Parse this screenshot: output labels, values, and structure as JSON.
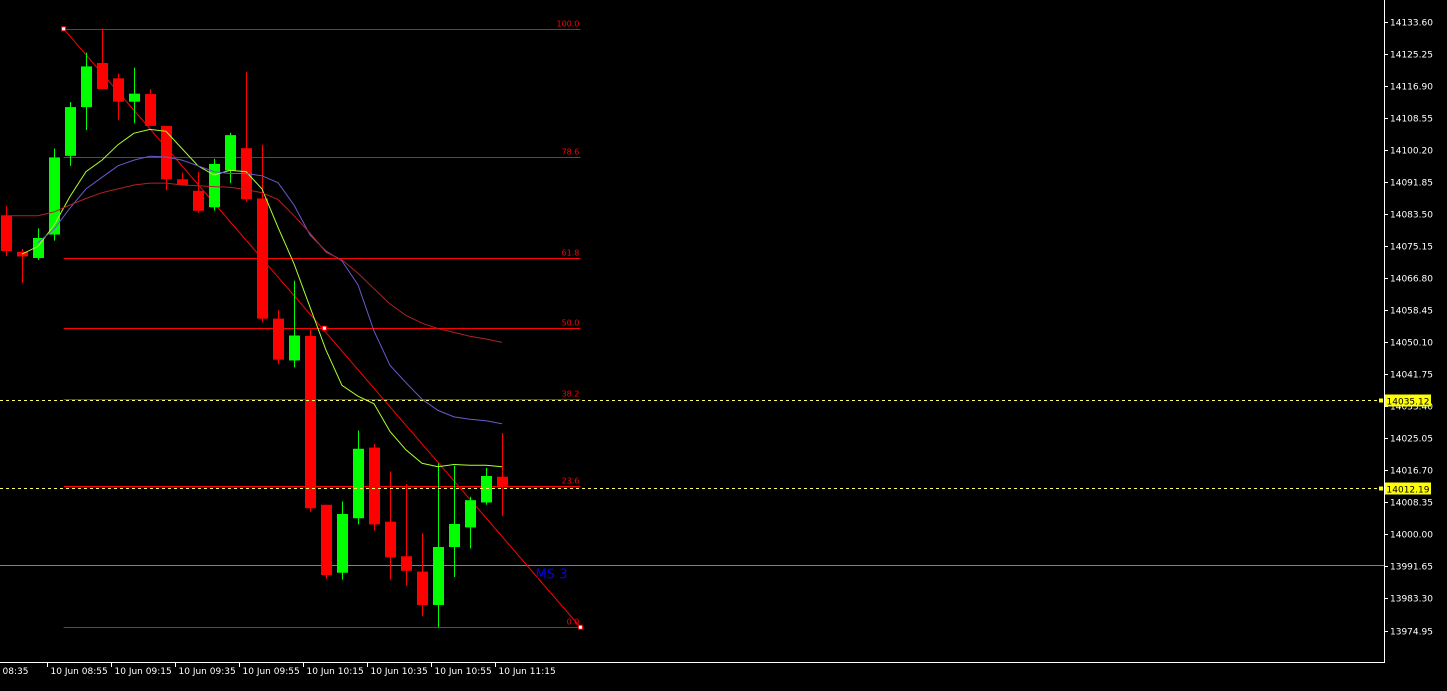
{
  "chart_data": {
    "type": "candlestick",
    "background": "#000000",
    "colors": {
      "bull": "#00ff00",
      "bear": "#ff0000",
      "fib": "#ff0000",
      "ma_fast": "#adff2f",
      "ma_mid": "#6a5acd",
      "ma_slow": "#b22222",
      "hline": "#808080",
      "dashed_level": "#ffff66",
      "price_tag_bg": "#ffff00",
      "axis_text": "#ffffff",
      "ms_label": "#0000ff"
    },
    "y_axis": {
      "ticks": [
        "14133.60",
        "14125.25",
        "14116.90",
        "14108.55",
        "14100.20",
        "14091.85",
        "14083.50",
        "14075.15",
        "14066.80",
        "14058.45",
        "14050.10",
        "14041.75",
        "14033.40",
        "14025.05",
        "14016.70",
        "14008.35",
        "14000.00",
        "13991.65",
        "13983.30",
        "13974.95"
      ],
      "range": [
        13972.0,
        14136.0
      ]
    },
    "x_axis": {
      "labels": [
        {
          "text": "08:35",
          "i": -0.45
        },
        {
          "text": "10 Jun 08:55",
          "i": 2.55
        },
        {
          "text": "10 Jun 09:15",
          "i": 6.55
        },
        {
          "text": "10 Jun 09:35",
          "i": 10.55
        },
        {
          "text": "10 Jun 09:55",
          "i": 14.55
        },
        {
          "text": "10 Jun 10:15",
          "i": 18.55
        },
        {
          "text": "10 Jun 10:35",
          "i": 22.55
        },
        {
          "text": "10 Jun 10:55",
          "i": 26.55
        },
        {
          "text": "10 Jun 11:15",
          "i": 30.55
        }
      ]
    },
    "candles": [
      {
        "o": 14083.0,
        "h": 14085.5,
        "l": 14072.5,
        "c": 14073.8
      },
      {
        "o": 14073.6,
        "h": 14074.3,
        "l": 14065.5,
        "c": 14072.4
      },
      {
        "o": 14072.0,
        "h": 14079.7,
        "l": 14071.5,
        "c": 14077.2
      },
      {
        "o": 14078.1,
        "h": 14100.5,
        "l": 14076.5,
        "c": 14098.2
      },
      {
        "o": 14098.6,
        "h": 14112.6,
        "l": 14096.0,
        "c": 14111.3
      },
      {
        "o": 14111.3,
        "h": 14125.5,
        "l": 14105.3,
        "c": 14121.9
      },
      {
        "o": 14122.8,
        "h": 14131.7,
        "l": 14116.3,
        "c": 14116.0
      },
      {
        "o": 14118.8,
        "h": 14120.0,
        "l": 14107.9,
        "c": 14112.7
      },
      {
        "o": 14112.7,
        "h": 14121.6,
        "l": 14107.1,
        "c": 14114.8
      },
      {
        "o": 14114.7,
        "h": 14116.0,
        "l": 14107.2,
        "c": 14106.4
      },
      {
        "o": 14106.4,
        "h": 14106.4,
        "l": 14089.6,
        "c": 14092.5
      },
      {
        "o": 14092.5,
        "h": 14094.2,
        "l": 14091.4,
        "c": 14091.0
      },
      {
        "o": 14089.5,
        "h": 14094.4,
        "l": 14083.8,
        "c": 14084.3
      },
      {
        "o": 14085.2,
        "h": 14097.8,
        "l": 14084.3,
        "c": 14096.5
      },
      {
        "o": 14094.8,
        "h": 14104.6,
        "l": 14091.5,
        "c": 14104.0
      },
      {
        "o": 14100.6,
        "h": 14120.5,
        "l": 14086.6,
        "c": 14087.3
      },
      {
        "o": 14087.5,
        "h": 14101.5,
        "l": 14055.3,
        "c": 14056.2
      },
      {
        "o": 14056.2,
        "h": 14058.4,
        "l": 14044.3,
        "c": 14045.5
      },
      {
        "o": 14045.3,
        "h": 14066.1,
        "l": 14043.5,
        "c": 14051.8
      },
      {
        "o": 14051.7,
        "h": 14053.3,
        "l": 14005.9,
        "c": 14006.8
      },
      {
        "o": 14007.7,
        "h": 14007.7,
        "l": 13988.4,
        "c": 13989.4
      },
      {
        "o": 13990.0,
        "h": 14008.6,
        "l": 13988.2,
        "c": 14005.3
      },
      {
        "o": 14004.2,
        "h": 14027.1,
        "l": 14002.6,
        "c": 14022.3
      },
      {
        "o": 14022.6,
        "h": 14023.5,
        "l": 14001.0,
        "c": 14002.6
      },
      {
        "o": 14003.3,
        "h": 14016.4,
        "l": 13988.2,
        "c": 13994.0
      },
      {
        "o": 13994.3,
        "h": 14013.1,
        "l": 13986.6,
        "c": 13990.5
      },
      {
        "o": 13990.3,
        "h": 14000.3,
        "l": 13978.7,
        "c": 13981.6
      },
      {
        "o": 13981.6,
        "h": 14018.5,
        "l": 13975.8,
        "c": 13996.7
      },
      {
        "o": 13996.7,
        "h": 14017.8,
        "l": 13988.9,
        "c": 14002.7
      },
      {
        "o": 14001.8,
        "h": 14009.8,
        "l": 13996.3,
        "c": 14008.9
      },
      {
        "o": 14008.3,
        "h": 14017.3,
        "l": 14007.7,
        "c": 14015.2
      },
      {
        "o": 14015.0,
        "h": 14026.4,
        "l": 14004.8,
        "c": 14012.2
      }
    ],
    "moving_averages": [
      {
        "color": "#adff2f",
        "values": [
          [
            1,
            14073.0
          ],
          [
            2,
            14075.0
          ],
          [
            3,
            14080.5
          ],
          [
            4,
            14088.0
          ],
          [
            5,
            14094.5
          ],
          [
            6,
            14097.5
          ],
          [
            7,
            14101.5
          ],
          [
            8,
            14104.5
          ],
          [
            9,
            14105.5
          ],
          [
            10,
            14105.0
          ],
          [
            11,
            14100.5
          ],
          [
            12,
            14096.0
          ],
          [
            13,
            14093.6
          ],
          [
            14,
            14094.8
          ],
          [
            15,
            14094.5
          ],
          [
            16,
            14090.0
          ],
          [
            17,
            14080.0
          ],
          [
            18,
            14070.5
          ],
          [
            19,
            14059.2
          ],
          [
            20,
            14048.0
          ],
          [
            21,
            14038.8
          ],
          [
            22,
            14036.0
          ],
          [
            23,
            14034.0
          ],
          [
            24,
            14026.8
          ],
          [
            25,
            14022.0
          ],
          [
            26,
            14018.5
          ],
          [
            27,
            14017.6
          ],
          [
            28,
            14018.2
          ],
          [
            29,
            14018.0
          ],
          [
            30,
            14018.0
          ],
          [
            31,
            14017.6
          ]
        ]
      },
      {
        "color": "#6a5acd",
        "values": [
          [
            2,
            14076.0
          ],
          [
            3,
            14079.5
          ],
          [
            4,
            14085.0
          ],
          [
            5,
            14090.0
          ],
          [
            6,
            14093.0
          ],
          [
            7,
            14096.0
          ],
          [
            8,
            14097.5
          ],
          [
            9,
            14098.5
          ],
          [
            10,
            14098.3
          ],
          [
            11,
            14097.5
          ],
          [
            12,
            14096.0
          ],
          [
            13,
            14094.5
          ],
          [
            14,
            14094.0
          ],
          [
            15,
            14094.0
          ],
          [
            16,
            14093.4
          ],
          [
            17,
            14091.6
          ],
          [
            18,
            14085.8
          ],
          [
            19,
            14078.0
          ],
          [
            20,
            14073.8
          ],
          [
            21,
            14071.2
          ],
          [
            22,
            14065.0
          ],
          [
            23,
            14053.0
          ],
          [
            24,
            14044.0
          ],
          [
            25,
            14039.5
          ],
          [
            26,
            14035.2
          ],
          [
            27,
            14032.3
          ],
          [
            28,
            14030.6
          ],
          [
            29,
            14030.0
          ],
          [
            30,
            14029.6
          ],
          [
            31,
            14028.8
          ]
        ]
      },
      {
        "color": "#b22222",
        "values": [
          [
            -0.3,
            14083.0
          ],
          [
            1,
            14083.0
          ],
          [
            2,
            14083.0
          ],
          [
            3,
            14084.0
          ],
          [
            4,
            14085.8
          ],
          [
            5,
            14087.5
          ],
          [
            6,
            14089.0
          ],
          [
            7,
            14090.0
          ],
          [
            8,
            14091.0
          ],
          [
            9,
            14091.5
          ],
          [
            10,
            14091.5
          ],
          [
            11,
            14091.0
          ],
          [
            12,
            14090.8
          ],
          [
            13,
            14090.6
          ],
          [
            14,
            14090.4
          ],
          [
            15,
            14089.8
          ],
          [
            16,
            14089.0
          ],
          [
            17,
            14087.2
          ],
          [
            18,
            14083.0
          ],
          [
            19,
            14078.5
          ],
          [
            20,
            14073.5
          ],
          [
            21,
            14071.5
          ],
          [
            22,
            14068.0
          ],
          [
            23,
            14064.0
          ],
          [
            24,
            14060.0
          ],
          [
            25,
            14057.0
          ],
          [
            26,
            14055.0
          ],
          [
            27,
            14053.6
          ],
          [
            28,
            14052.6
          ],
          [
            29,
            14051.6
          ],
          [
            30,
            14050.9
          ],
          [
            31,
            14050.0
          ]
        ]
      }
    ],
    "fibonacci": {
      "levels": [
        {
          "label": "100.0",
          "price": 14131.7
        },
        {
          "label": "78.6",
          "price": 14098.3
        },
        {
          "label": "61.8",
          "price": 14072.1
        },
        {
          "label": "50.0",
          "price": 14053.7
        },
        {
          "label": "38.2",
          "price": 14035.3
        },
        {
          "label": "23.6",
          "price": 14012.5
        },
        {
          "label": "0.0",
          "price": 13975.8
        }
      ],
      "trendline": {
        "from": [
          3.6,
          14131.7
        ],
        "to": [
          35.9,
          13975.8
        ]
      },
      "mid_marker": [
        19.9,
        14053.7
      ]
    },
    "horizontal_line": {
      "price": 13992.0
    },
    "dashed_levels": [
      {
        "price": 14035.12,
        "label": "14035.12"
      },
      {
        "price": 14012.19,
        "label": "14012.19"
      }
    ],
    "annotations": [
      {
        "text": "MS 3",
        "i": 33.1,
        "price": 13990.0
      }
    ]
  }
}
